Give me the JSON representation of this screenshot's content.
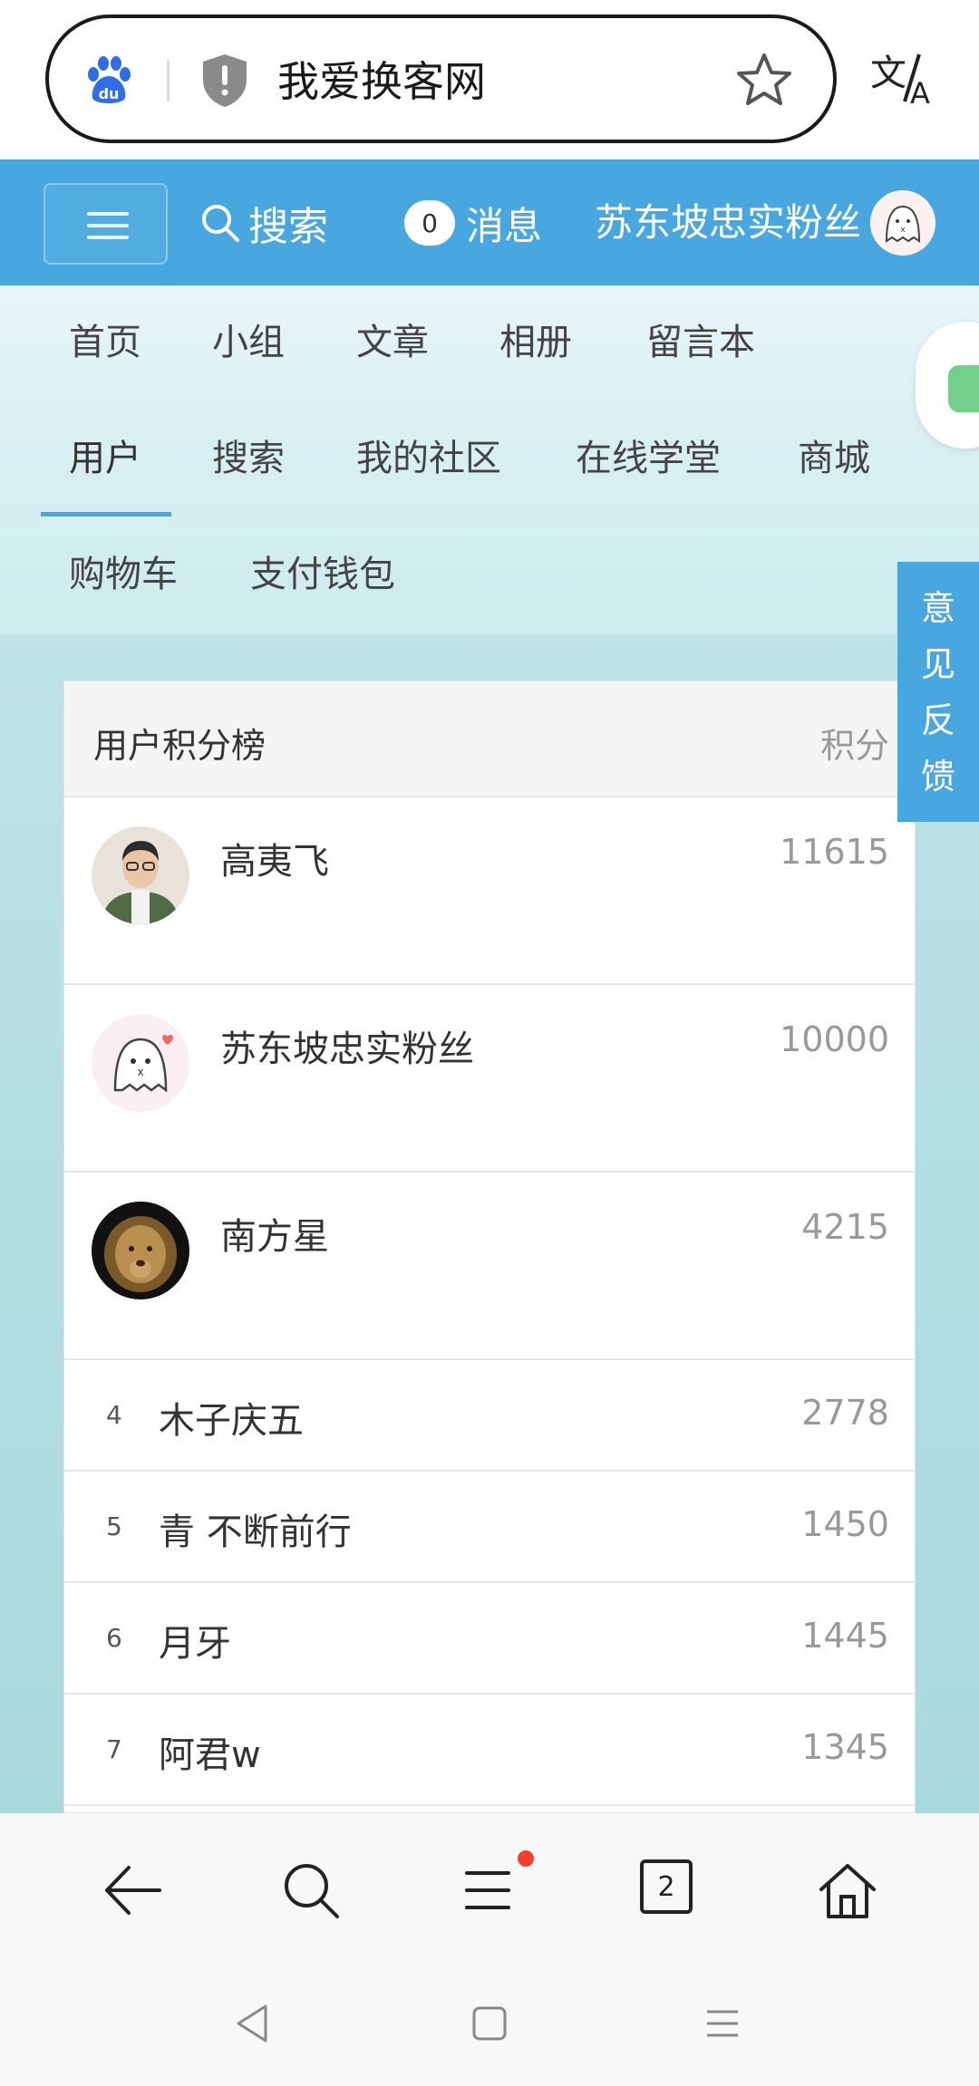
{
  "address_bar": {
    "title": "我爱换客网"
  },
  "header": {
    "search_label": "搜索",
    "message_count": "0",
    "message_label": "消息",
    "username": "苏东坡忠实粉丝"
  },
  "nav": {
    "active": "用户",
    "items": [
      "首页",
      "小组",
      "文章",
      "相册",
      "留言本",
      "用户",
      "搜索",
      "我的社区",
      "在线学堂",
      "商城",
      "购物车",
      "支付钱包"
    ]
  },
  "feedback": {
    "chars": [
      "意",
      "见",
      "反",
      "馈"
    ]
  },
  "leaderboard": {
    "title": "用户积分榜",
    "score_header": "积分",
    "top": [
      {
        "name": "高夷飞",
        "score": "11615"
      },
      {
        "name": "苏东坡忠实粉丝",
        "score": "10000"
      },
      {
        "name": "南方星",
        "score": "4215"
      }
    ],
    "rest": [
      {
        "rank": "4",
        "name": "木子庆五",
        "score": "2778"
      },
      {
        "rank": "5",
        "name": "青 不断前行",
        "score": "1450"
      },
      {
        "rank": "6",
        "name": "月牙",
        "score": "1445"
      },
      {
        "rank": "7",
        "name": "阿君w",
        "score": "1345"
      }
    ]
  },
  "toolbar": {
    "tab_count": "2"
  },
  "colors": {
    "header_blue": "#48a7df",
    "notify_red": "#f2402e"
  }
}
